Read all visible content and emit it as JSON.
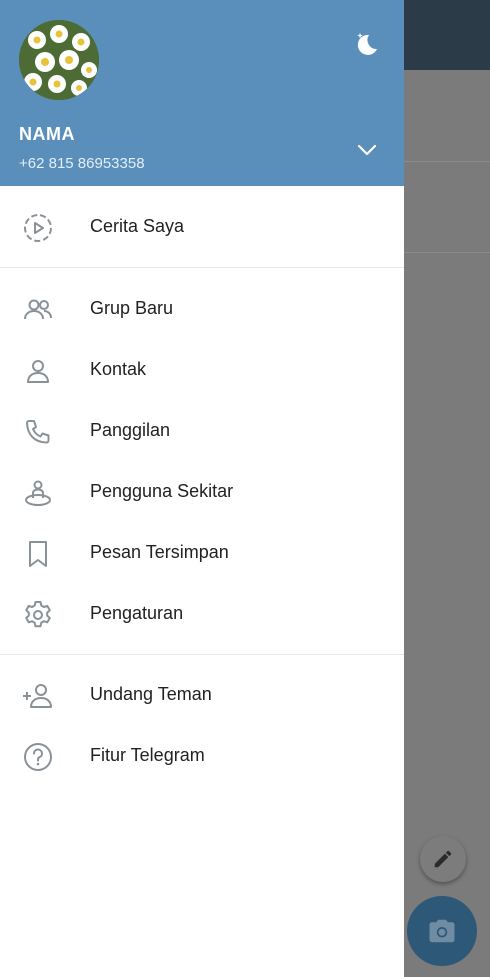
{
  "user": {
    "name": "NAMA",
    "phone": "+62 815 86953358"
  },
  "menu": {
    "stories": {
      "label": "Cerita Saya",
      "icon": "story-icon"
    },
    "main": [
      {
        "label": "Grup Baru",
        "icon": "group-icon"
      },
      {
        "label": "Kontak",
        "icon": "contact-icon"
      },
      {
        "label": "Panggilan",
        "icon": "phone-icon"
      },
      {
        "label": "Pengguna Sekitar",
        "icon": "nearby-people-icon"
      },
      {
        "label": "Pesan Tersimpan",
        "icon": "bookmark-icon"
      },
      {
        "label": "Pengaturan",
        "icon": "gear-icon"
      }
    ],
    "extra": [
      {
        "label": "Undang Teman",
        "icon": "add-user-icon"
      },
      {
        "label": "Fitur Telegram",
        "icon": "question-icon"
      }
    ]
  },
  "colors": {
    "header": "#5a8fbb",
    "icon": "#8a9197",
    "fab": "#2d5878"
  }
}
